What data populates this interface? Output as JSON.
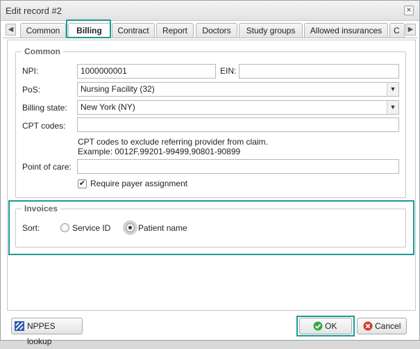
{
  "dialog": {
    "title": "Edit record #2"
  },
  "tabs": [
    {
      "label": "Common"
    },
    {
      "label": "Billing"
    },
    {
      "label": "Contract"
    },
    {
      "label": "Report"
    },
    {
      "label": "Doctors"
    },
    {
      "label": "Study groups"
    },
    {
      "label": "Allowed insurances"
    },
    {
      "label": "C"
    }
  ],
  "common": {
    "legend": "Common",
    "npi_label": "NPI:",
    "npi_value": "1000000001",
    "ein_label": "EIN:",
    "ein_value": "",
    "pos_label": "PoS:",
    "pos_value": "Nursing Facility (32)",
    "billing_state_label": "Billing state:",
    "billing_state_value": "New York (NY)",
    "cpt_label": "CPT codes:",
    "cpt_value": "",
    "cpt_note_line1": "CPT codes to exclude referring provider from claim.",
    "cpt_note_line2": "Example: 0012F,99201-99499,90801-90899",
    "poc_label": "Point of care:",
    "poc_value": "",
    "require_payer_label": "Require payer assignment",
    "require_payer_checked": true
  },
  "invoices": {
    "legend": "Invoices",
    "sort_label": "Sort:",
    "options": [
      {
        "label": "Service ID",
        "checked": false
      },
      {
        "label": "Patient name",
        "checked": true
      }
    ]
  },
  "footer": {
    "nppes_label": "NPPES lookup",
    "ok_label": "OK",
    "cancel_label": "Cancel"
  },
  "colors": {
    "highlight": "#1a9a95",
    "ok_icon": "#3aa64a",
    "cancel_icon": "#d23a2a",
    "nppes_icon": "#2a5db0"
  }
}
